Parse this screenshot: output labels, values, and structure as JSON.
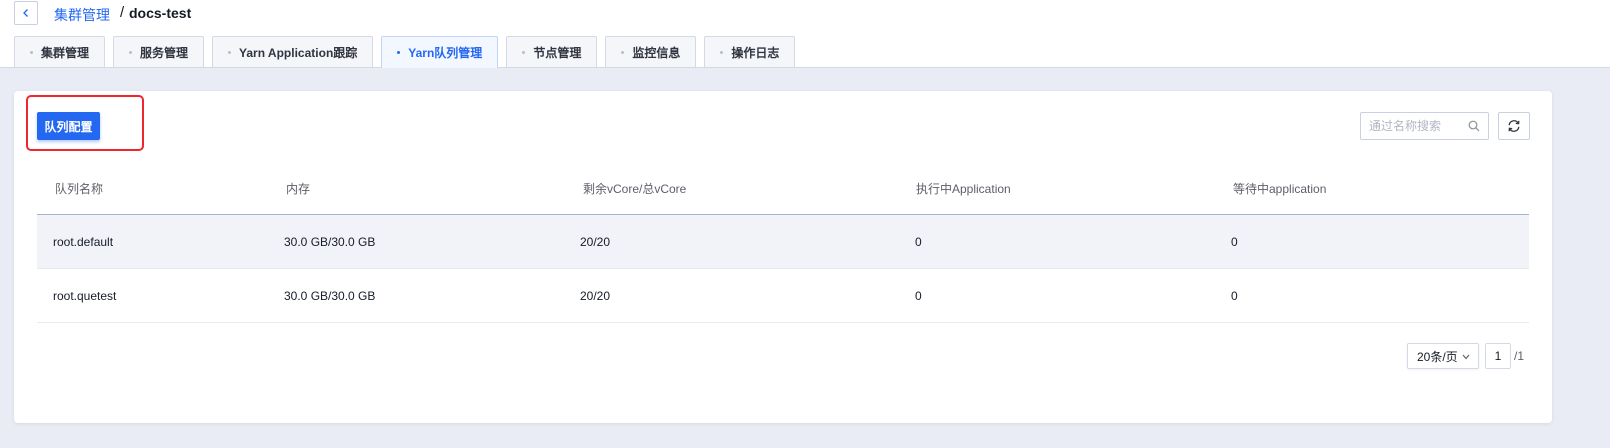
{
  "breadcrumb": {
    "parent": "集群管理",
    "separator": "/",
    "current": "docs-test"
  },
  "tabs": [
    {
      "label": "集群管理",
      "active": false
    },
    {
      "label": "服务管理",
      "active": false
    },
    {
      "label": "Yarn Application跟踪",
      "active": false
    },
    {
      "label": "Yarn队列管理",
      "active": true
    },
    {
      "label": "节点管理",
      "active": false
    },
    {
      "label": "监控信息",
      "active": false
    },
    {
      "label": "操作日志",
      "active": false
    }
  ],
  "toolbar": {
    "queue_config_label": "队列配置",
    "search_placeholder": "通过名称搜索"
  },
  "table": {
    "headers": [
      "队列名称",
      "内存",
      "剩余vCore/总vCore",
      "执行中Application",
      "等待中application"
    ],
    "rows": [
      [
        "root.default",
        "30.0 GB/30.0 GB",
        "20/20",
        "0",
        "0"
      ],
      [
        "root.quetest",
        "30.0 GB/30.0 GB",
        "20/20",
        "0",
        "0"
      ]
    ]
  },
  "pagination": {
    "page_size": "20条/页",
    "current_page": "1",
    "total_pages": "/1"
  },
  "colors": {
    "primary": "#2468f2",
    "highlight_border": "#f0262f",
    "page_bg": "#e9ecf4"
  },
  "icons": {
    "back": "chevron-left-icon",
    "search": "search-icon",
    "refresh": "refresh-icon",
    "dropdown": "chevron-down-icon"
  }
}
